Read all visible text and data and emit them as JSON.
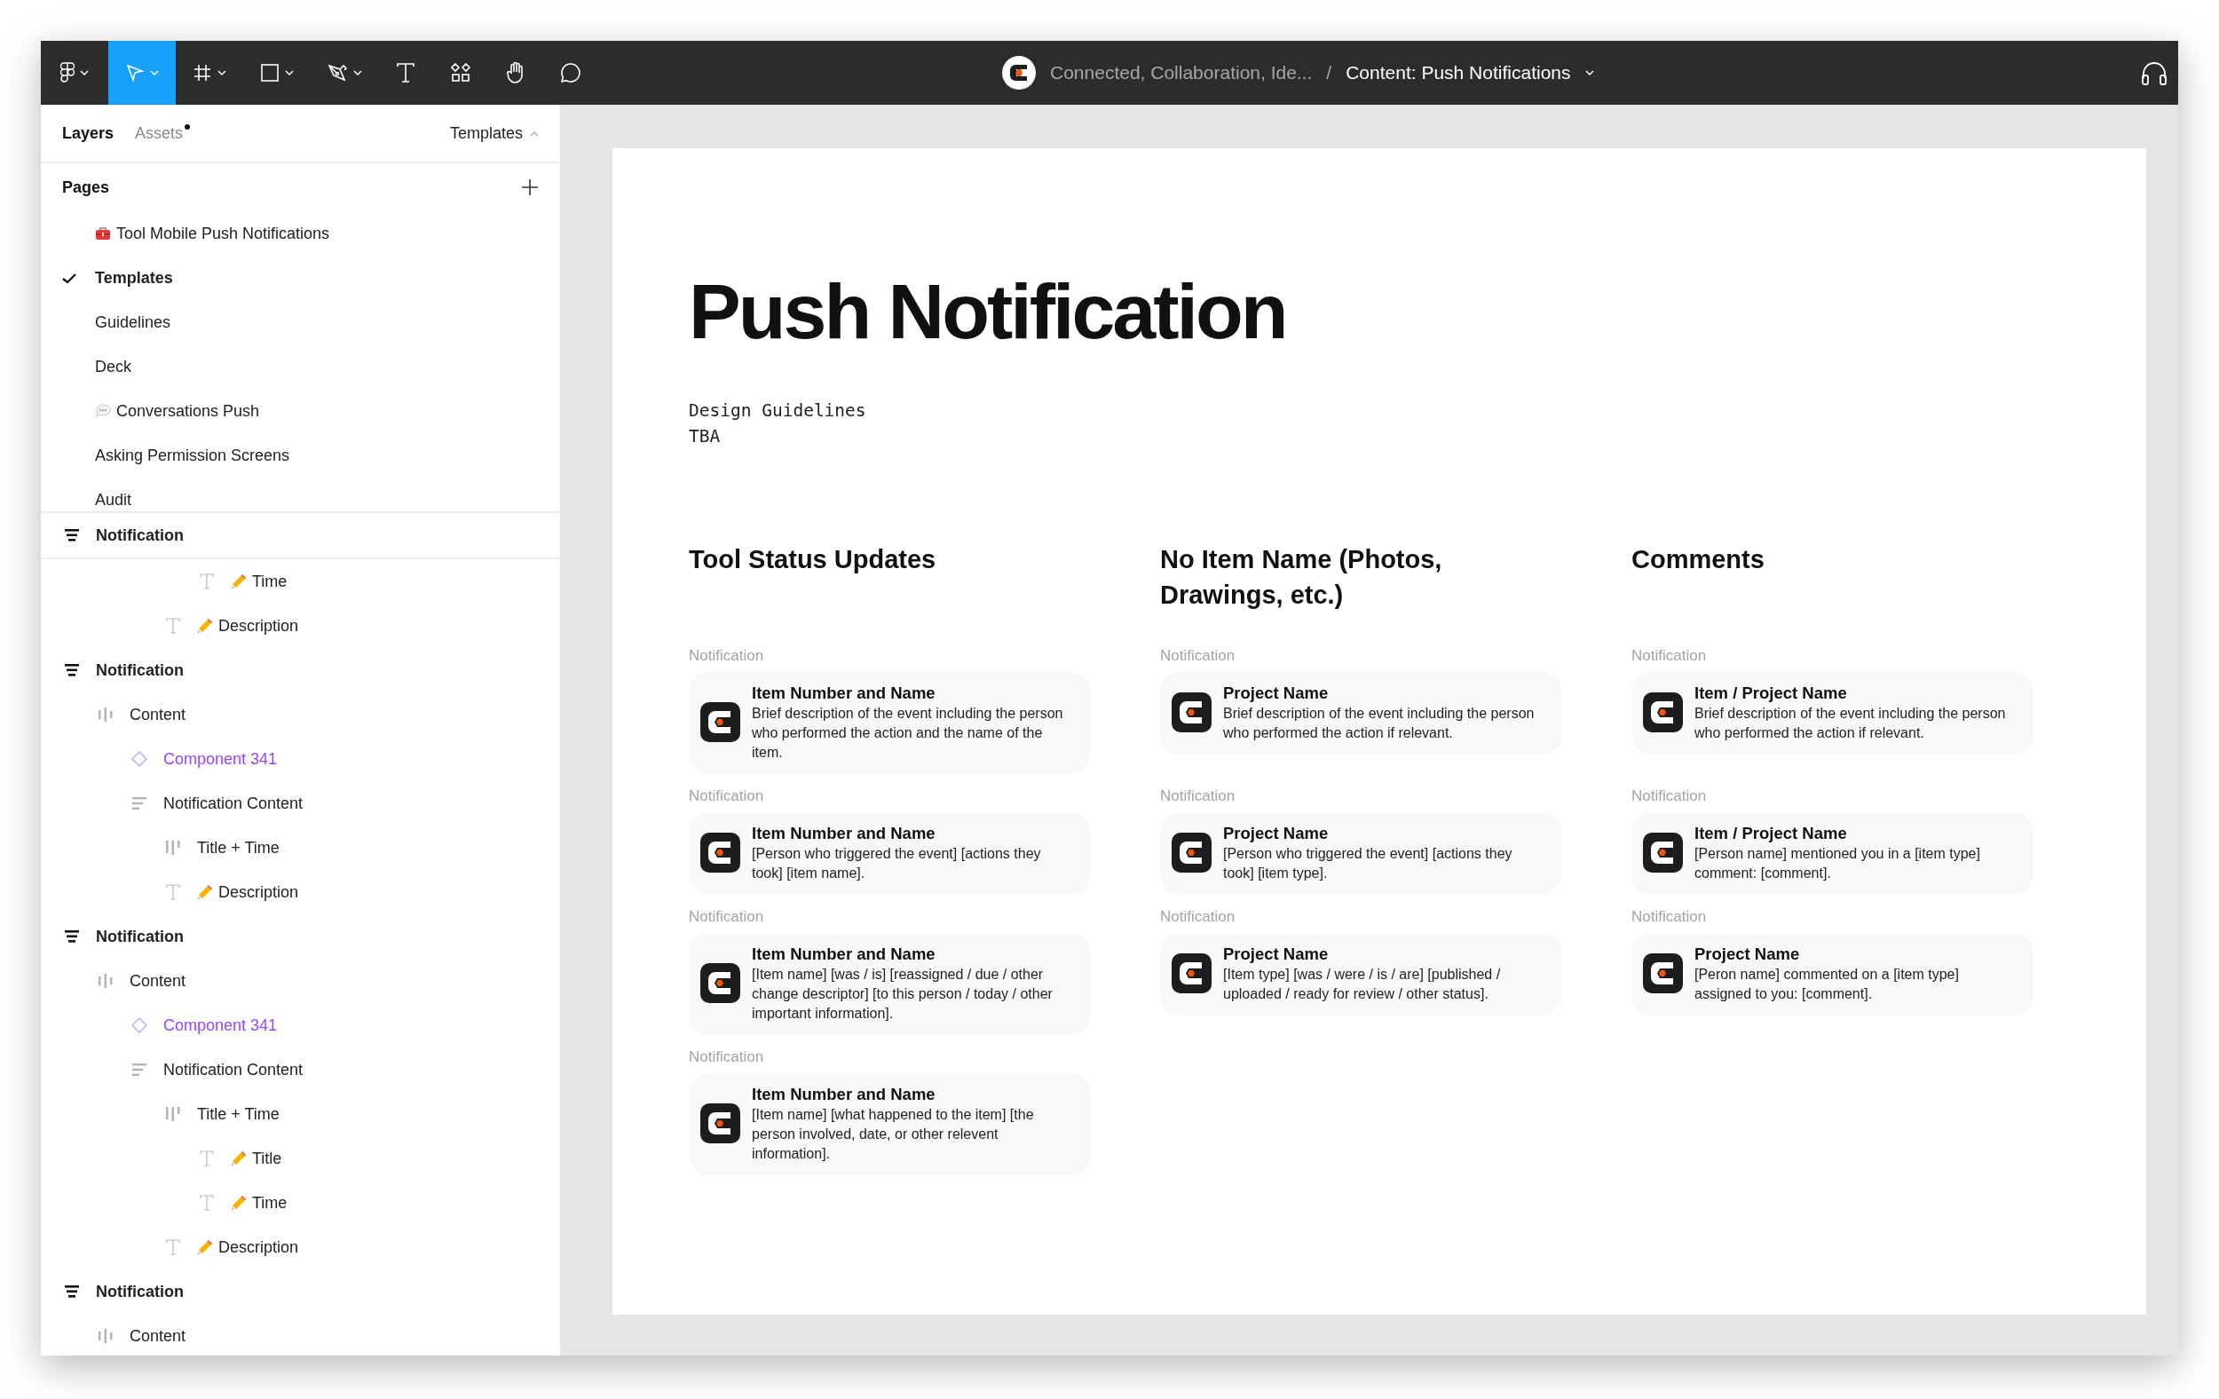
{
  "toolbar": {
    "tools": [
      {
        "kind": "main-menu",
        "selected": false,
        "caret": true
      },
      {
        "kind": "move",
        "selected": true,
        "caret": true
      },
      {
        "kind": "frame",
        "selected": false,
        "caret": true
      },
      {
        "kind": "rectangle",
        "selected": false,
        "caret": true
      },
      {
        "kind": "pen",
        "selected": false,
        "caret": true
      },
      {
        "kind": "text",
        "selected": false,
        "caret": false
      },
      {
        "kind": "components",
        "selected": false,
        "caret": false
      },
      {
        "kind": "hand",
        "selected": false,
        "caret": false
      },
      {
        "kind": "comment",
        "selected": false,
        "caret": false
      }
    ],
    "breadcrumb": {
      "project": "Connected, Collaboration, Ide...",
      "separator": "/",
      "file": "Content: Push Notifications"
    }
  },
  "sidebar": {
    "tabs": [
      {
        "label": "Layers",
        "selected": true,
        "badge": false
      },
      {
        "label": "Assets",
        "selected": false,
        "badge": true
      }
    ],
    "page_dropdown": "Templates",
    "pages_heading": "Pages",
    "pages": [
      {
        "label": "Tool Mobile Push Notifications",
        "kind": "toolbox",
        "selected": false
      },
      {
        "label": "Templates",
        "kind": "plain",
        "selected": true
      },
      {
        "label": "Guidelines",
        "kind": "plain",
        "selected": false
      },
      {
        "label": "Deck",
        "kind": "plain",
        "selected": false
      },
      {
        "label": "Conversations Push",
        "kind": "chat",
        "selected": false
      },
      {
        "label": "Asking Permission Screens",
        "kind": "plain",
        "selected": false
      },
      {
        "label": "Audit",
        "kind": "plain",
        "selected": false
      }
    ],
    "layers": [
      {
        "name": "Notification",
        "kind": "frame",
        "pinned": true,
        "children": [
          {
            "children": [
              {
                "children": [
                  {
                    "children": [
                      {
                        "name": "Time",
                        "kind": "text"
                      }
                    ]
                  },
                  {
                    "name": "Description",
                    "kind": "text"
                  }
                ]
              }
            ]
          }
        ]
      },
      {
        "name": "Notification",
        "kind": "frame",
        "pinned": false,
        "children": [
          {
            "name": "Content",
            "kind": "row",
            "children": [
              {
                "name": "Component 341",
                "kind": "component"
              },
              {
                "name": "Notification Content",
                "kind": "column",
                "children": [
                  {
                    "name": "Title + Time",
                    "kind": "row-top"
                  },
                  {
                    "name": "Description",
                    "kind": "text"
                  }
                ]
              }
            ]
          }
        ]
      },
      {
        "name": "Notification",
        "kind": "frame",
        "pinned": false,
        "children": [
          {
            "name": "Content",
            "kind": "row",
            "children": [
              {
                "name": "Component 341",
                "kind": "component"
              },
              {
                "name": "Notification Content",
                "kind": "column",
                "children": [
                  {
                    "name": "Title + Time",
                    "kind": "row-top",
                    "children": [
                      {
                        "name": "Title",
                        "kind": "text"
                      },
                      {
                        "name": "Time",
                        "kind": "text"
                      }
                    ]
                  },
                  {
                    "name": "Description",
                    "kind": "text"
                  }
                ]
              }
            ]
          }
        ]
      },
      {
        "name": "Notification",
        "kind": "frame",
        "pinned": false,
        "children": [
          {
            "name": "Content",
            "kind": "row"
          }
        ]
      }
    ]
  },
  "canvas": {
    "title": "Push Notification",
    "subtitle": [
      "Design Guidelines",
      "TBA"
    ],
    "columns": [
      {
        "heading": "Tool Status Updates",
        "notifications": [
          {
            "label": "Notification",
            "title": "Item Number and Name",
            "description": "Brief description of the event including the person who performed the action and the name of the item."
          },
          {
            "label": "Notification",
            "title": "Item Number and Name",
            "description": "[Person who triggered the event] [actions they took] [item name]."
          },
          {
            "label": "Notification",
            "title": "Item Number and Name",
            "description": "[Item name] [was / is] [reassigned / due / other change descriptor] [to this person / today / other important information]."
          },
          {
            "label": "Notification",
            "title": "Item Number and Name",
            "description": "[Item name] [what happened to the item] [the person involved, date, or other relevent information]."
          }
        ]
      },
      {
        "heading": "No Item Name (Photos, Drawings, etc.)",
        "notifications": [
          {
            "label": "Notification",
            "title": "Project Name",
            "description": "Brief description of the event including the person who performed the action if relevant."
          },
          {
            "label": "Notification",
            "title": "Project Name",
            "description": "[Person who triggered the event] [actions they took] [item type]."
          },
          {
            "label": "Notification",
            "title": "Project Name",
            "description": "[Item type] [was / were / is / are] [published / uploaded / ready for review / other status]."
          }
        ]
      },
      {
        "heading": "Comments",
        "notifications": [
          {
            "label": "Notification",
            "title": "Item / Project Name",
            "description": "Brief description of the event including the person who performed the action if relevant."
          },
          {
            "label": "Notification",
            "title": "Item / Project Name",
            "description": "[Person name] mentioned you in a [item type] comment: [comment]."
          },
          {
            "label": "Notification",
            "title": "Project Name",
            "description": "[Peron name] commented on a [item type] assigned to you: [comment]."
          }
        ]
      }
    ]
  }
}
